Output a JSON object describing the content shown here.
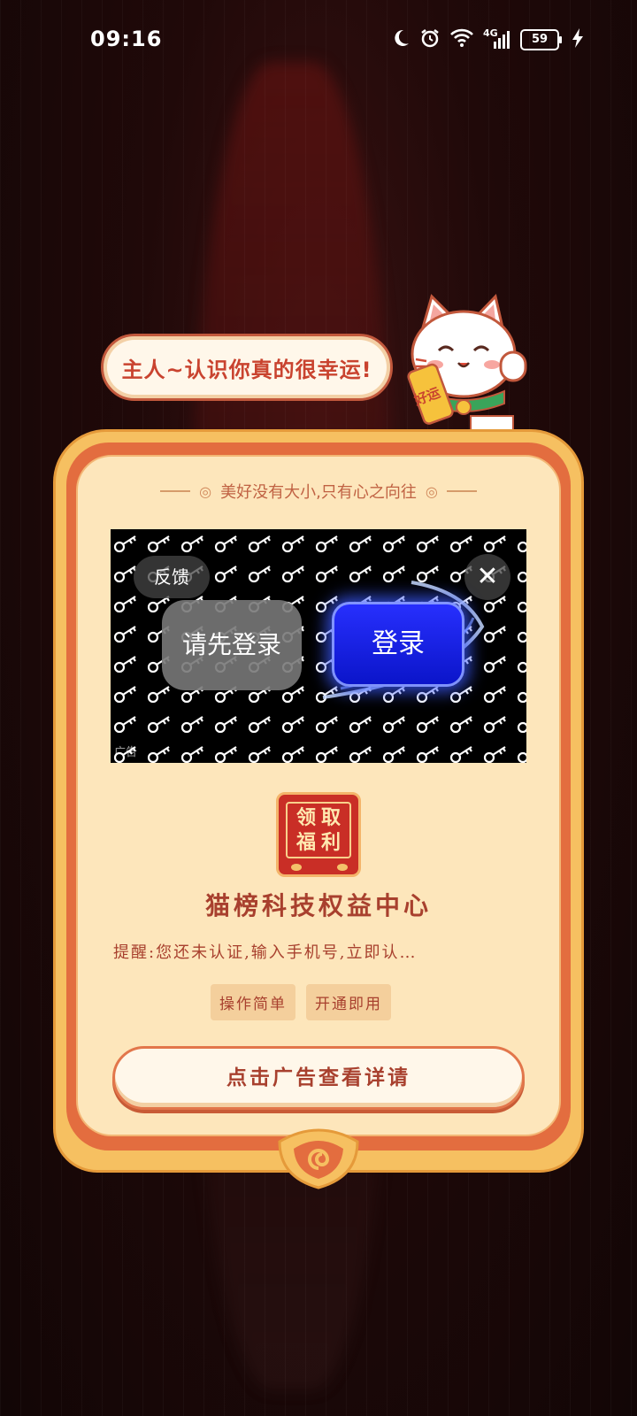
{
  "status_bar": {
    "time": "09:16",
    "network": "4G",
    "battery": "59",
    "icons": [
      "moon-icon",
      "alarm-icon",
      "wifi-icon",
      "signal-icon",
      "battery-icon",
      "charging-icon"
    ]
  },
  "bubble": {
    "text": "主人~认识你真的很幸运!"
  },
  "mascot": {
    "badge_text": "好运"
  },
  "card": {
    "motto": "美好没有大小,只有心之向往",
    "ad": {
      "feedback_label": "反馈",
      "close_label": "✕",
      "login_first_label": "请先登录",
      "login_button_label": "登录",
      "ad_tag": "广告"
    },
    "reward_icon": {
      "chars": [
        "领",
        "取",
        "福",
        "利"
      ]
    },
    "title": "猫榜科技权益中心",
    "reminder": "提醒:您还未认证,输入手机号,立即认…",
    "tags": [
      "操作简单",
      "开通即用"
    ],
    "cta_label": "点击广告查看详请"
  },
  "colors": {
    "background": "#1b0808",
    "card_gold": "#f6c061",
    "card_orange": "#e36d3f",
    "card_cream": "#fde6bb",
    "text_red": "#a8402e",
    "login_blue": "#1a22f0"
  }
}
